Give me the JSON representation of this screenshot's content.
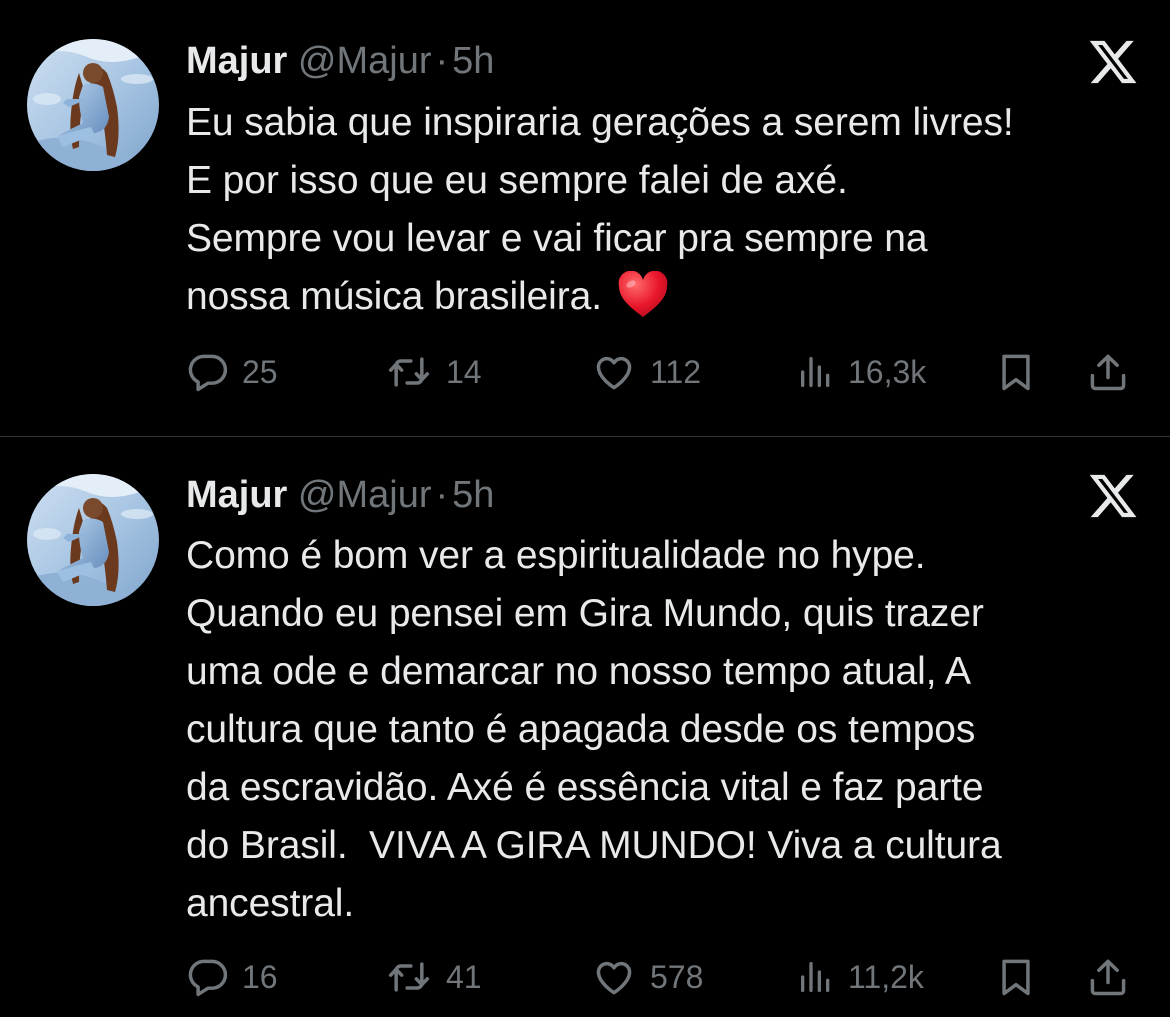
{
  "tweets": [
    {
      "author_name": "Majur",
      "author_handle": "@Majur",
      "separator": "·",
      "time": "5h",
      "text_lines": [
        "Eu sabia que inspiraria gerações a serem livres!",
        "E por isso que eu sempre falei de axé.",
        "Sempre vou levar e vai ficar pra sempre na",
        "nossa música brasileira."
      ],
      "emoji": "red-heart",
      "stats": {
        "replies": "25",
        "retweets": "14",
        "likes": "112",
        "views": "16,3k"
      }
    },
    {
      "author_name": "Majur",
      "author_handle": "@Majur",
      "separator": "·",
      "time": "5h",
      "text_lines": [
        "Como é bom ver a espiritualidade no hype.",
        "Quando eu pensei em Gira Mundo, quis trazer",
        "uma ode e demarcar no nosso tempo atual, A",
        "cultura que tanto é apagada desde os tempos",
        "da escravidão. Axé é essência vital e faz parte",
        "do Brasil.  VIVA A GIRA MUNDO! Viva a cultura",
        "ancestral."
      ],
      "stats": {
        "replies": "16",
        "retweets": "41",
        "likes": "578",
        "views": "11,2k"
      }
    }
  ],
  "icons": [
    "x-logo-icon",
    "reply-icon",
    "retweet-icon",
    "like-icon",
    "views-icon",
    "bookmark-icon",
    "share-icon",
    "red-heart-emoji"
  ],
  "colors": {
    "background": "#000000",
    "text": "#e7e9ea",
    "secondary": "#71767b",
    "divider": "#2f3336",
    "heart": "#e8152a"
  }
}
